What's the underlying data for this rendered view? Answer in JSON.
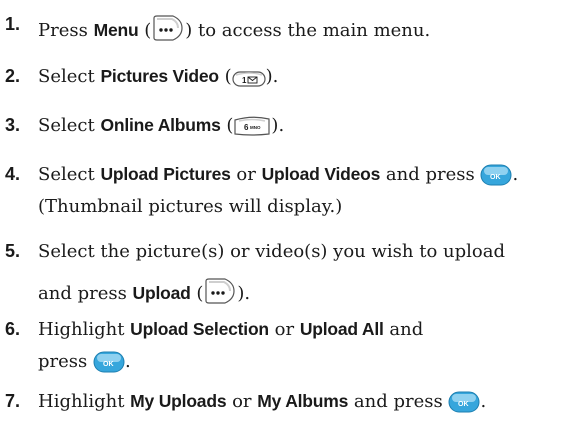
{
  "steps": [
    {
      "num": "1.",
      "p1": "Press ",
      "b1": "Menu",
      "p2": " (",
      "p3": ") to access the main menu."
    },
    {
      "num": "2.",
      "p1": "Select ",
      "b1": "Pictures Video",
      "p2": " (",
      "p3": ")."
    },
    {
      "num": "3.",
      "p1": "Select ",
      "b1": "Online Albums",
      "p2": " (",
      "p3": ")."
    },
    {
      "num": "4.",
      "p1": "Select ",
      "b1": "Upload Pictures",
      "p2": " or ",
      "b2": "Upload Videos",
      "p3": " and press ",
      "p4": ".",
      "line2": "(Thumbnail pictures will display.)"
    },
    {
      "num": "5.",
      "line1": "Select the picture(s) or video(s) you wish to upload",
      "p1": "and press ",
      "b1": "Upload",
      "p2": " (",
      "p3": ")."
    },
    {
      "num": "6.",
      "p1": "Highlight ",
      "b1": "Upload Selection",
      "p2": " or ",
      "b2": "Upload All",
      "p3": " and",
      "l2a": "press ",
      "l2b": "."
    },
    {
      "num": "7.",
      "p1": "Highlight ",
      "b1": "My Uploads",
      "p2": " or ",
      "b2": "My Albums",
      "p3": " and press ",
      "p4": "."
    }
  ],
  "keys": {
    "one_key_label": "1",
    "six_key_label": "6",
    "six_key_sub": "MNO",
    "ok_key_label": "OK"
  },
  "icons": {
    "menu_key": "softkey-dots-icon",
    "one_key": "key-1-envelope-icon",
    "six_key": "key-6-mno-icon",
    "ok_key": "ok-button-icon"
  },
  "colors": {
    "text": "#1a1a1a",
    "ok_blue": "#36a6dc",
    "key_border": "#555555"
  }
}
